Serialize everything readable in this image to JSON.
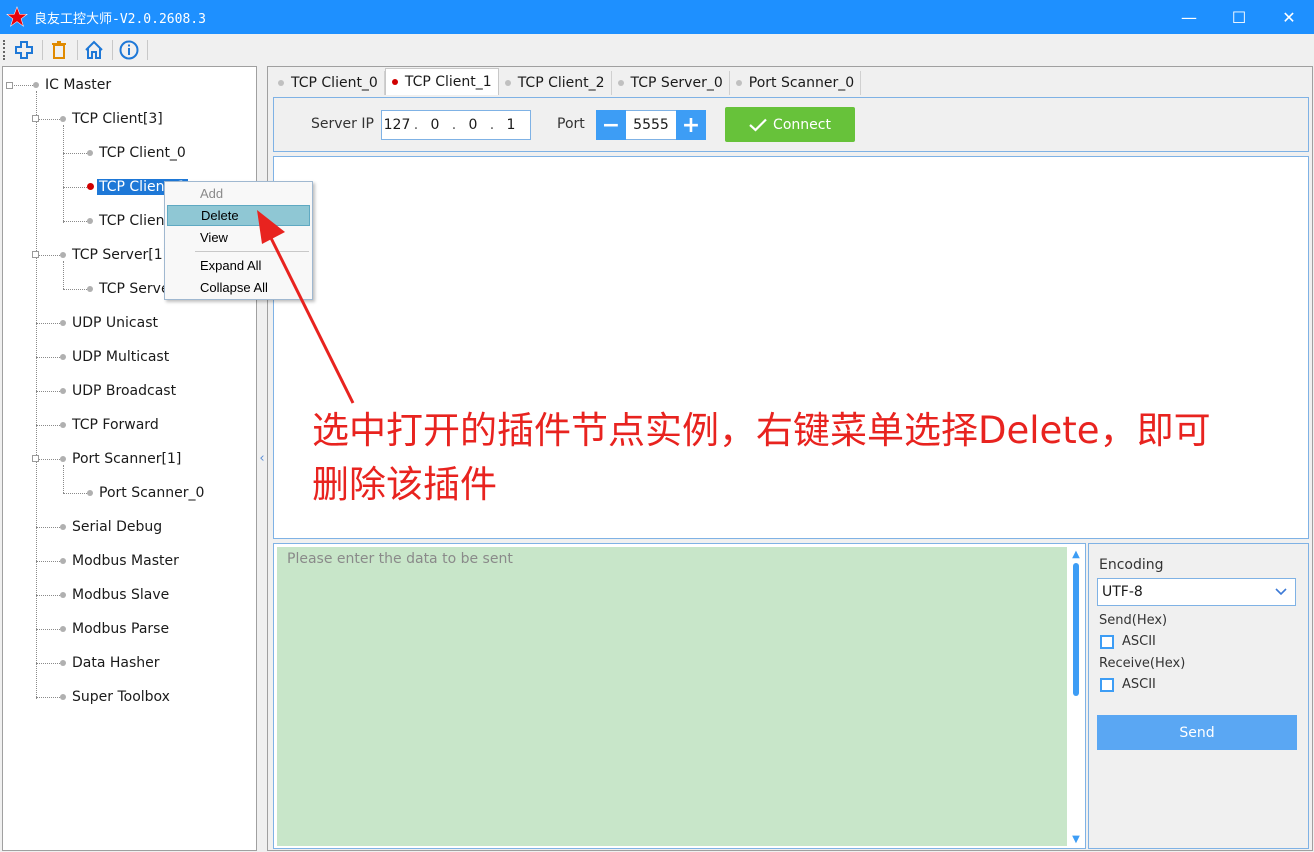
{
  "window": {
    "title": "良友工控大师-V2.0.2608.3",
    "minimize": "—",
    "maximize": "☐",
    "close": "✕"
  },
  "toolbar": {
    "icons": [
      "add-icon",
      "delete-icon",
      "home-icon",
      "info-icon"
    ],
    "colors": {
      "add": "#1e78d7",
      "delete": "#e08a00",
      "home": "#1e78d7",
      "info": "#1e78d7"
    }
  },
  "tree": {
    "root": "IC Master",
    "tcp_client": "TCP Client[3]",
    "tcp_client_0": "TCP Client_0",
    "tcp_client_1": "TCP Client_1",
    "tcp_client_2": "TCP Client_2",
    "tcp_server": "TCP Server[1]",
    "tcp_server_0": "TCP Server_0",
    "udp_unicast": "UDP Unicast",
    "udp_multicast": "UDP Multicast",
    "udp_broadcast": "UDP Broadcast",
    "tcp_forward": "TCP Forward",
    "port_scanner": "Port Scanner[1]",
    "port_scanner_0": "Port Scanner_0",
    "serial_debug": "Serial Debug",
    "modbus_master": "Modbus Master",
    "modbus_slave": "Modbus Slave",
    "modbus_parse": "Modbus Parse",
    "data_hasher": "Data Hasher",
    "super_toolbox": "Super Toolbox"
  },
  "context_menu": {
    "add": "Add",
    "delete": "Delete",
    "view": "View",
    "expand_all": "Expand All",
    "collapse_all": "Collapse All"
  },
  "tabs": [
    {
      "label": "TCP Client_0",
      "active": false
    },
    {
      "label": "TCP Client_1",
      "active": true
    },
    {
      "label": "TCP Client_2",
      "active": false
    },
    {
      "label": "TCP Server_0",
      "active": false
    },
    {
      "label": "Port Scanner_0",
      "active": false
    }
  ],
  "connection": {
    "server_ip_label": "Server IP",
    "ip": [
      "127",
      "0",
      "0",
      "1"
    ],
    "port_label": "Port",
    "port": "5555",
    "minus": "−",
    "plus": "+",
    "connect_label": "Connect"
  },
  "send": {
    "placeholder": "Please enter the data to be sent"
  },
  "settings": {
    "encoding_label": "Encoding",
    "encoding_value": "UTF-8",
    "send_hex_label": "Send(Hex)",
    "send_ascii": "ASCII",
    "receive_hex_label": "Receive(Hex)",
    "receive_ascii": "ASCII",
    "send_button": "Send"
  },
  "annotation": {
    "line1": "选中打开的插件节点实例，右键菜单选择Delete，即可",
    "line2": "删除该插件",
    "color": "#e8231f"
  }
}
